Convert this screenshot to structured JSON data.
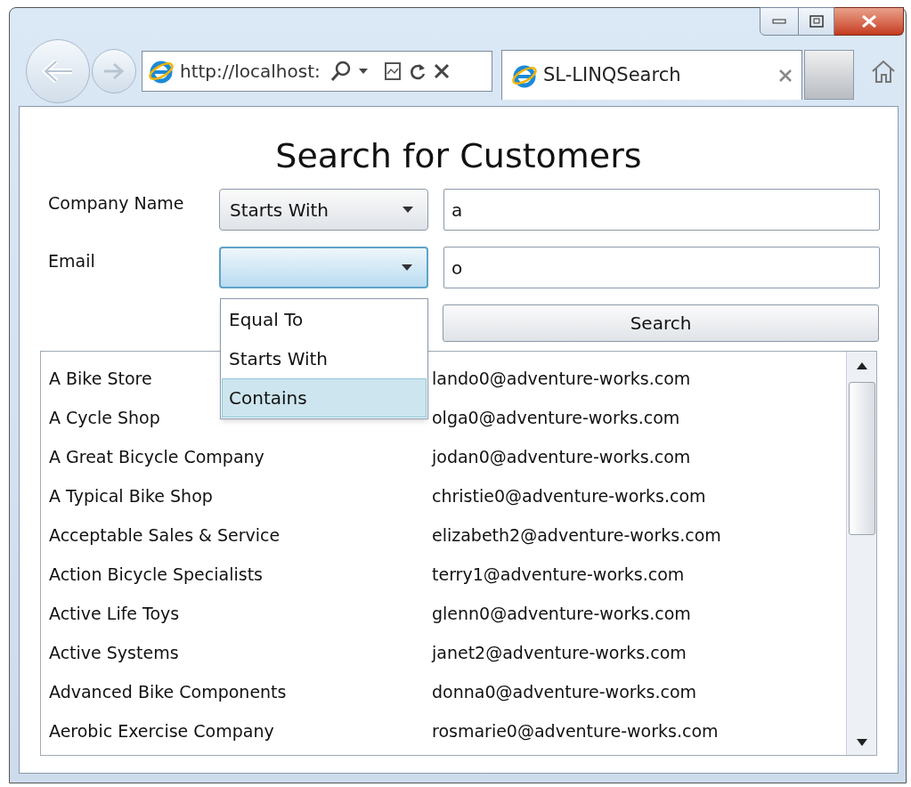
{
  "browser": {
    "address": "http://localhost:",
    "tab_title": "SL-LINQSearch"
  },
  "title": "Search for Customers",
  "filters": [
    {
      "label": "Company Name",
      "operator": "Starts With",
      "value": "a",
      "focused": false,
      "open": false
    },
    {
      "label": "Email",
      "value": "o",
      "focused": true,
      "open": true
    }
  ],
  "dropdown_options": [
    {
      "label": "Equal To",
      "selected": false
    },
    {
      "label": "Starts With",
      "selected": false
    },
    {
      "label": "Contains",
      "selected": true
    }
  ],
  "search_button": "Search",
  "results": [
    {
      "company": "A Bike Store",
      "email": "lando0@adventure-works.com"
    },
    {
      "company": "A Cycle Shop",
      "email": "olga0@adventure-works.com"
    },
    {
      "company": "A Great Bicycle Company",
      "email": "jodan0@adventure-works.com"
    },
    {
      "company": "A Typical Bike Shop",
      "email": "christie0@adventure-works.com"
    },
    {
      "company": "Acceptable Sales & Service",
      "email": "elizabeth2@adventure-works.com"
    },
    {
      "company": "Action Bicycle Specialists",
      "email": "terry1@adventure-works.com"
    },
    {
      "company": "Active Life Toys",
      "email": "glenn0@adventure-works.com"
    },
    {
      "company": "Active Systems",
      "email": "janet2@adventure-works.com"
    },
    {
      "company": "Advanced Bike Components",
      "email": "donna0@adventure-works.com"
    },
    {
      "company": "Aerobic Exercise Company",
      "email": "rosmarie0@adventure-works.com"
    }
  ]
}
